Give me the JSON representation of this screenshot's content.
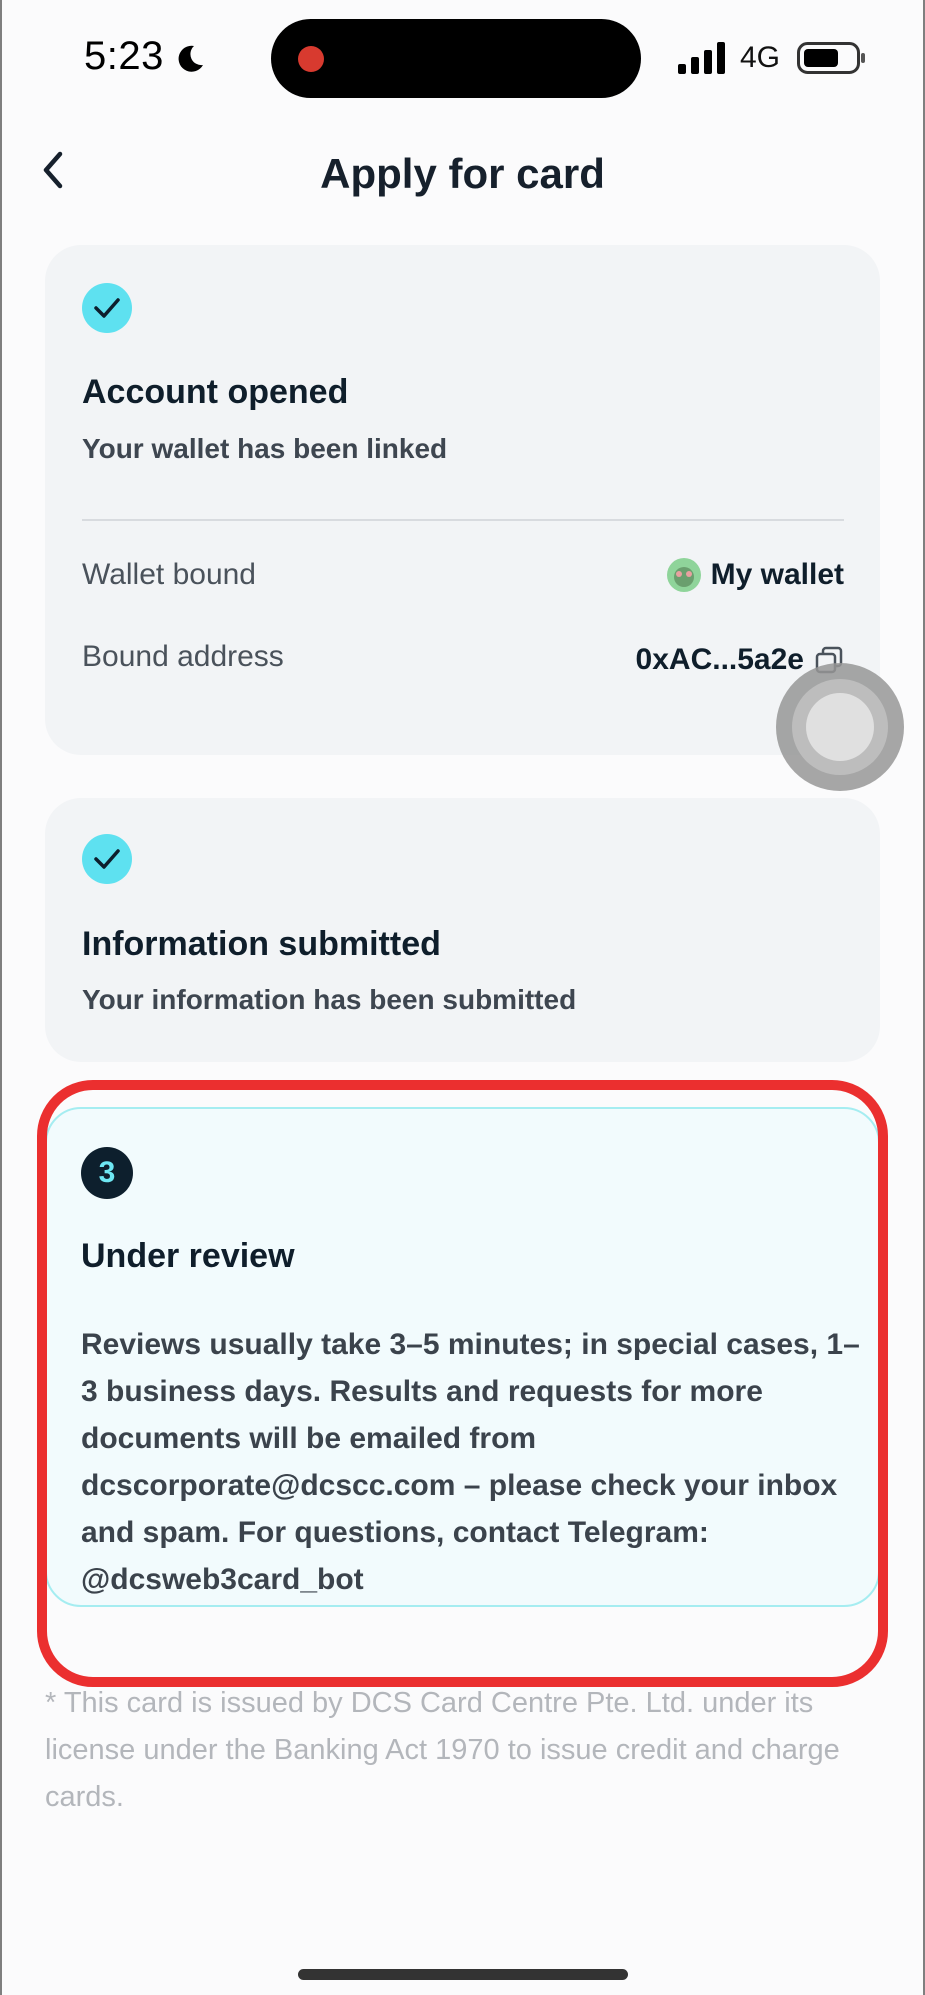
{
  "status_bar": {
    "time": "5:23",
    "network": "4G",
    "icons": [
      "moon-icon",
      "signal-icon",
      "battery-icon"
    ]
  },
  "header": {
    "title": "Apply for card",
    "back_icon": "chevron-left-icon"
  },
  "steps": [
    {
      "state": "done",
      "title": "Account opened",
      "subtitle": "Your wallet has been linked",
      "rows": [
        {
          "label": "Wallet bound",
          "value": "My wallet"
        },
        {
          "label": "Bound address",
          "value": "0xAC...5a2e"
        }
      ]
    },
    {
      "state": "done",
      "title": "Information submitted",
      "subtitle": "Your information has been submitted"
    },
    {
      "state": "current",
      "number": "3",
      "title": "Under review",
      "description": "Reviews usually take 3–5 minutes; in special cases, 1–3 business days. Results and requests for more documents will be emailed from dcscorporate@dcscc.com – please check your inbox and spam. For questions, contact Telegram: @dcsweb3card_bot"
    }
  ],
  "footnote": "* This card is issued by DCS Card Centre Pte. Ltd. under its license under the Banking Act 1970 to issue credit and charge cards.",
  "colors": {
    "accent": "#5ee1f0",
    "highlight": "#eb2f2f",
    "dark": "#0f1e2b"
  }
}
